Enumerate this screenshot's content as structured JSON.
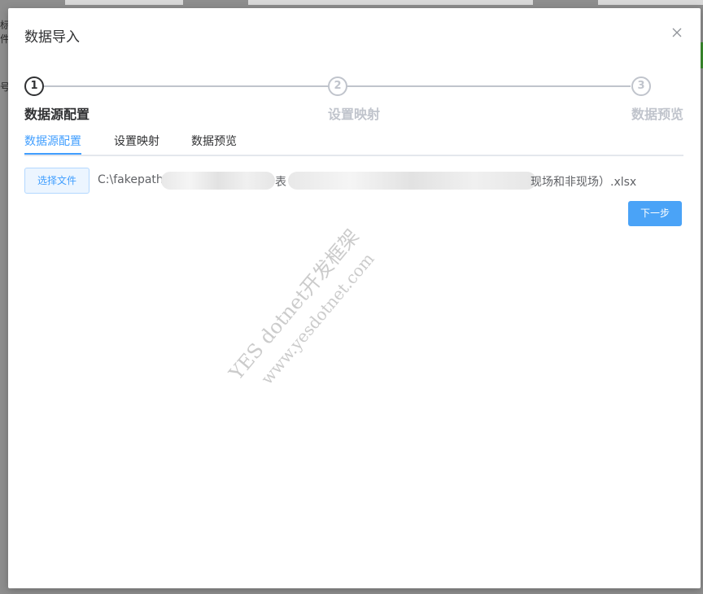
{
  "background": {
    "fragment_1": "标件",
    "fragment_2": "号"
  },
  "dialog": {
    "title": "数据导入",
    "close_icon": "close-icon"
  },
  "steps": [
    {
      "number": "1",
      "label": "数据源配置",
      "active": true
    },
    {
      "number": "2",
      "label": "设置映射",
      "active": false
    },
    {
      "number": "3",
      "label": "数据预览",
      "active": false
    }
  ],
  "tabs": [
    {
      "label": "数据源配置",
      "active": true
    },
    {
      "label": "设置映射",
      "active": false
    },
    {
      "label": "数据预览",
      "active": false
    }
  ],
  "file": {
    "button_label": "选择文件",
    "path_start": "C:\\fakepath",
    "path_mid": "表",
    "path_end": "现场和非现场）.xlsx"
  },
  "actions": {
    "next_label": "下一步"
  },
  "watermark": {
    "line1": "YES dotnet开发框架",
    "line2": "www.yesdotnet.com"
  },
  "colors": {
    "accent": "#409eff",
    "next_button": "#4aa3f7",
    "inactive": "#c0c4cc",
    "text": "#303133"
  }
}
